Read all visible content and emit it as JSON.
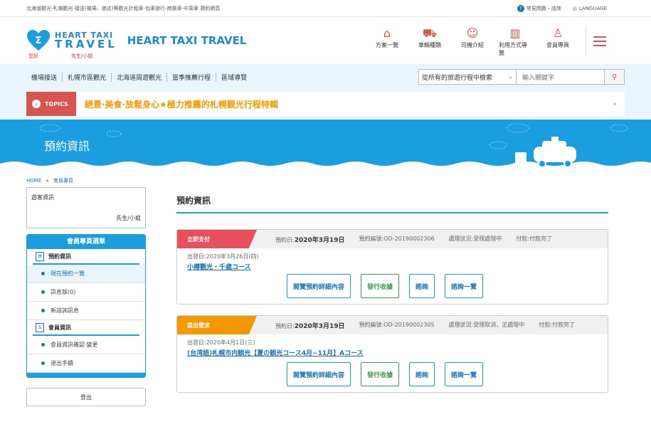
{
  "topbar": {
    "tagline": "北海道觀光-札幌觀光-接送(機場、旅店)等觀光計程車-包車旅行-商務車-中周車 預約網頁",
    "faq": "常見問題・諮詢",
    "language": "LANGUAGE"
  },
  "header": {
    "logo_line1": "HEART TAXI",
    "logo_line2": "TRAVEL",
    "brand": "HEART TAXI TRAVEL",
    "greeting": "您好",
    "user_suffix": "先生/小姐",
    "nav": [
      {
        "label": "方案一覽",
        "icon": "briefcase-icon"
      },
      {
        "label": "車輛種類",
        "icon": "car-icon"
      },
      {
        "label": "司機介紹",
        "icon": "driver-icon"
      },
      {
        "label": "利用方式導覽",
        "icon": "book-icon"
      },
      {
        "label": "會員專頁",
        "icon": "user-icon"
      }
    ]
  },
  "subnav": {
    "links": [
      "機場接送",
      "札幌市區觀光",
      "北海道周遊觀光",
      "當季推薦行程",
      "區域導覽"
    ],
    "search_select": "從所有的旅遊行程中檢索",
    "search_placeholder": "輸入關鍵字"
  },
  "topics": {
    "label": "TOPICS",
    "text": "絕景·美食·放鬆身心★極力推薦的札幌觀光行程特輯"
  },
  "hero": {
    "title": "預約資訊"
  },
  "breadcrumb": {
    "home": "HOME",
    "sep": "»",
    "current": "會員專頁"
  },
  "sidebar": {
    "user_label": "遊客資訊",
    "user_suffix": "先生/小姐",
    "menu_title": "會員專頁選單",
    "sec1": "預約資訊",
    "items1": [
      "現在預約一覽",
      "訊息版(0)",
      "新諮詢訊息"
    ],
    "sec2": "會員資訊",
    "items2": [
      "會員資訊確認·變更",
      "退出手續"
    ],
    "logout": "登出"
  },
  "content": {
    "title": "預約資訊",
    "cards": [
      {
        "badge": "立即支付",
        "date_label": "預約日:",
        "date": "2020年3月19日",
        "order": "預約編號:OD-20190002306",
        "status": "處理狀況:受理處理中",
        "payment": "付款:付款完了",
        "depart": "出發日:2020年3月26日(四)",
        "plan": "小樽觀光・千歳コース"
      },
      {
        "badge": "提出需求",
        "date_label": "預約日:",
        "date": "2020年3月19日",
        "order": "預約編號:OD-20190002305",
        "status": "處理狀況:受理取消，正處理中",
        "payment": "付款:付款完了",
        "depart": "出發日:2020年4月1日(三)",
        "plan": "(台湾語)札幌市内観光【夏の観光コース4月~11月】Aコース"
      }
    ],
    "buttons": [
      "閱覽預約詳細內容",
      "發行收據",
      "諮詢",
      "諮詢一覽"
    ]
  }
}
